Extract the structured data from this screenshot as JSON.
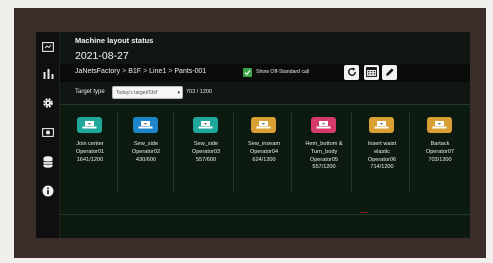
{
  "header": {
    "title": "Machine layout status",
    "date": "2021-08-27"
  },
  "breadcrumb": {
    "items": [
      "JaNetsFactory",
      "B1F",
      "Line1",
      "Pants-001"
    ],
    "separator": ">"
  },
  "toolbar": {
    "off_standard_label": "Show Off-Standard call",
    "off_standard_checked": true
  },
  "filter": {
    "label": "Target type",
    "selected": "Today's target/Shif",
    "count": "703 / 1200"
  },
  "stations": [
    {
      "name": "Join center",
      "operator": "Operator01",
      "count": "1641/1200",
      "color": "#1ea79a"
    },
    {
      "name": "Sew_side",
      "operator": "Operator02",
      "count": "430/600",
      "color": "#1e86c8"
    },
    {
      "name": "Sew_side",
      "operator": "Operator03",
      "count": "557/600",
      "color": "#1ea79a"
    },
    {
      "name": "Sew_inseam",
      "operator": "Operator04",
      "count": "624/1200",
      "color": "#d8a032"
    },
    {
      "name": "Hem_bottom &",
      "name2": "Turn_body",
      "operator": "Operator05",
      "count": "557/1200",
      "color": "#d63a6a"
    },
    {
      "name": "Insert waist",
      "name2": "elastic",
      "operator": "Operator06",
      "count": "714/1200",
      "color": "#d8a032"
    },
    {
      "name": "Bartack",
      "operator": "Operator07",
      "count": "703/1200",
      "color": "#d8a032"
    }
  ],
  "sidebar": {
    "icons": [
      "monitor-icon",
      "bar-chart-icon",
      "settings-icon",
      "camera-icon",
      "database-icon",
      "info-icon"
    ]
  }
}
